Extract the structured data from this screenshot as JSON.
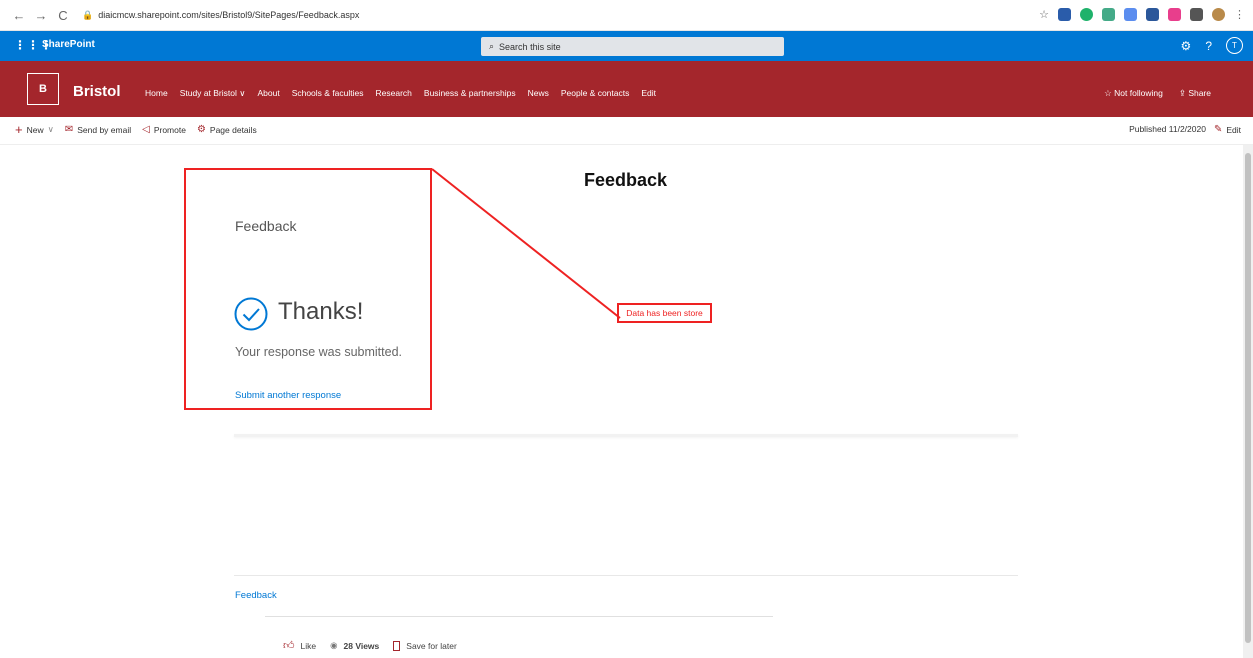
{
  "browser": {
    "url": "diaicmcw.sharepoint.com/sites/Bristol9/SitePages/Feedback.aspx",
    "back": "←",
    "forward": "→",
    "reload": "C",
    "star": "☆",
    "menu": "⋮"
  },
  "suite": {
    "waffle": "⋮⋮⋮",
    "brand": "SharePoint",
    "search_label": "Search this site",
    "settings": "⚙",
    "help": "?",
    "avatar": "T"
  },
  "site": {
    "logo": "B",
    "title": "Bristol",
    "nav": [
      "Home",
      "Study at Bristol",
      "About",
      "Schools & faculties",
      "Research",
      "Business & partnerships",
      "News",
      "People & contacts",
      "Edit"
    ],
    "not_following": "Not following",
    "share": "Share"
  },
  "commands": {
    "new": "New",
    "send_email": "Send by email",
    "promote": "Promote",
    "page_details": "Page details",
    "published": "Published 11/2/2020",
    "edit": "Edit"
  },
  "content": {
    "heading": "Feedback",
    "form_title": "Feedback",
    "thanks": "Thanks!",
    "submitted": "Your response was submitted.",
    "another": "Submit another response",
    "annotation": "Data has been store"
  },
  "footer": {
    "link": "Feedback",
    "like": "Like",
    "views": "28 Views",
    "save": "Save for later"
  },
  "colors": {
    "suite_blue": "#0078d4",
    "site_red": "#a4262c",
    "annotation_red": "#e22"
  }
}
